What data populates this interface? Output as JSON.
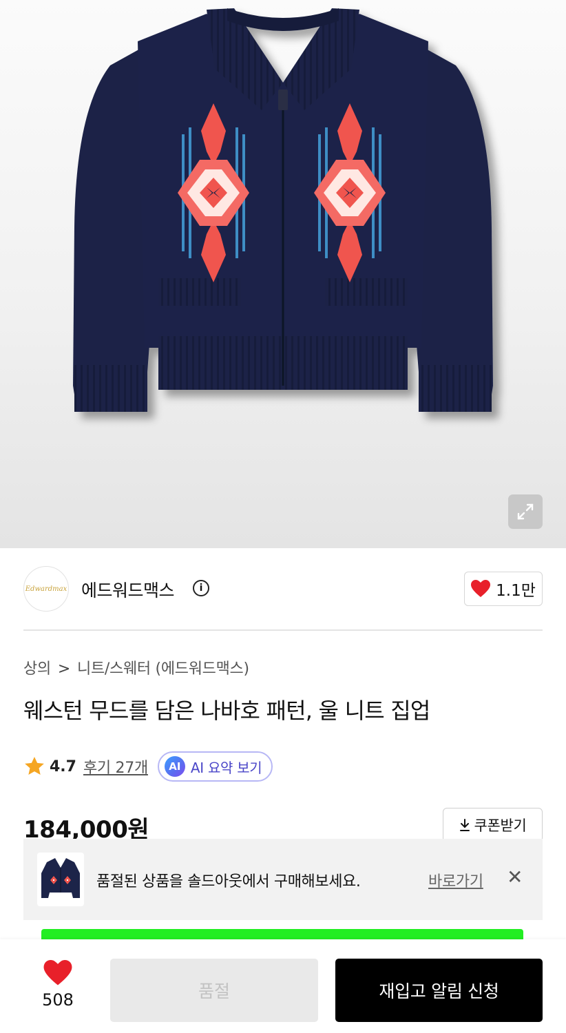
{
  "hero": {
    "product_image": "navy-knit-zip-cardigan",
    "expand_icon": "expand-icon"
  },
  "brand": {
    "logo_text": "Edwardmax",
    "name": "에드워드맥스",
    "info_icon": "info-icon",
    "info_glyph": "i",
    "likes": "1.1만"
  },
  "breadcrumb": {
    "category": "상의",
    "separator": ">",
    "subcategory": "니트/스웨터 (에드워드맥스)"
  },
  "product": {
    "title": "웨스턴 무드를 담은 나바호 패턴, 울 니트 집업",
    "rating": "4.7",
    "reviews": "후기 27개",
    "ai_badge": "AI",
    "ai_summary": "AI 요약 보기",
    "price": "184,000원",
    "coupon": "쿠폰받기"
  },
  "banner": {
    "text": "품절된 상품을 솔드아웃에서 구매해보세요.",
    "link": "바로가기",
    "close": "✕"
  },
  "bottom_bar": {
    "like_count": "508",
    "soldout_label": "품절",
    "restock_label": "재입고 알림 신청"
  },
  "colors": {
    "heart": "#e8202a",
    "ai_accent": "#4a46c8",
    "star": "#f5a623",
    "knit_navy": "#1b2347"
  }
}
